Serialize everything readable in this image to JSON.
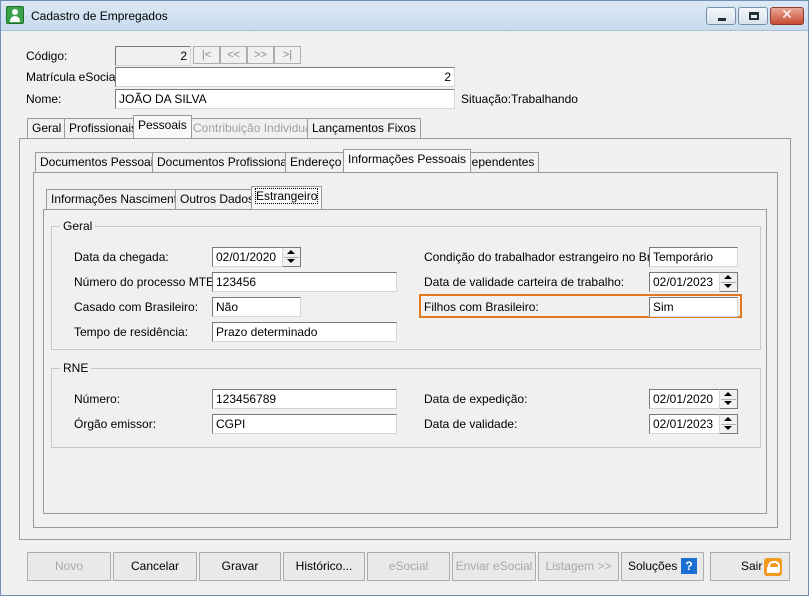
{
  "window": {
    "title": "Cadastro de Empregados"
  },
  "header": {
    "codigo_label": "Código:",
    "codigo_value": "2",
    "nav": [
      "|<",
      "<<",
      ">>",
      ">|"
    ],
    "matricula_label": "Matrícula eSocial:",
    "matricula_value": "2",
    "nome_label": "Nome:",
    "nome_value": "JOÃO DA SILVA",
    "situacao_label": "Situação:",
    "situacao_value": "Trabalhando"
  },
  "main_tabs": [
    "Geral",
    "Profissionais",
    "Pessoais",
    "Contribuição Individual",
    "Lançamentos Fixos"
  ],
  "sub_tabs": [
    "Documentos Pessoais",
    "Documentos Profissionais",
    "Endereço",
    "Informações Pessoais",
    "Dependentes"
  ],
  "inner_tabs": [
    "Informações Nascimento",
    "Outros Dados",
    "Estrangeiro"
  ],
  "geral": {
    "title": "Geral",
    "data_chegada_label": "Data da chegada:",
    "data_chegada_value": "02/01/2020",
    "processo_label": "Número do processo MTE:",
    "processo_value": "123456",
    "casado_label": "Casado com Brasileiro:",
    "casado_value": "Não",
    "tempo_label": "Tempo de residência:",
    "tempo_value": "Prazo determinado",
    "condicao_label": "Condição do trabalhador estrangeiro no Brasil:",
    "condicao_value": "Temporário",
    "validade_ct_label": "Data de validade carteira de trabalho:",
    "validade_ct_value": "02/01/2023",
    "filhos_label": "Filhos com Brasileiro:",
    "filhos_value": "Sim"
  },
  "rne": {
    "title": "RNE",
    "numero_label": "Número:",
    "numero_value": "123456789",
    "orgao_label": "Órgão emissor:",
    "orgao_value": "CGPI",
    "expedicao_label": "Data de expedição:",
    "expedicao_value": "02/01/2020",
    "validade_label": "Data de validade:",
    "validade_value": "02/01/2023"
  },
  "buttons": {
    "novo": "Novo",
    "cancelar": "Cancelar",
    "gravar": "Gravar",
    "historico": "Histórico...",
    "esocial": "eSocial",
    "enviar_esocial": "Enviar eSocial",
    "listagem": "Listagem >>",
    "solucoes": "Soluções",
    "sair": "Sair"
  },
  "colors": {
    "highlight": "#e27920",
    "help_icon": "#1b6fd1",
    "exit_icon": "#f39a1f"
  }
}
